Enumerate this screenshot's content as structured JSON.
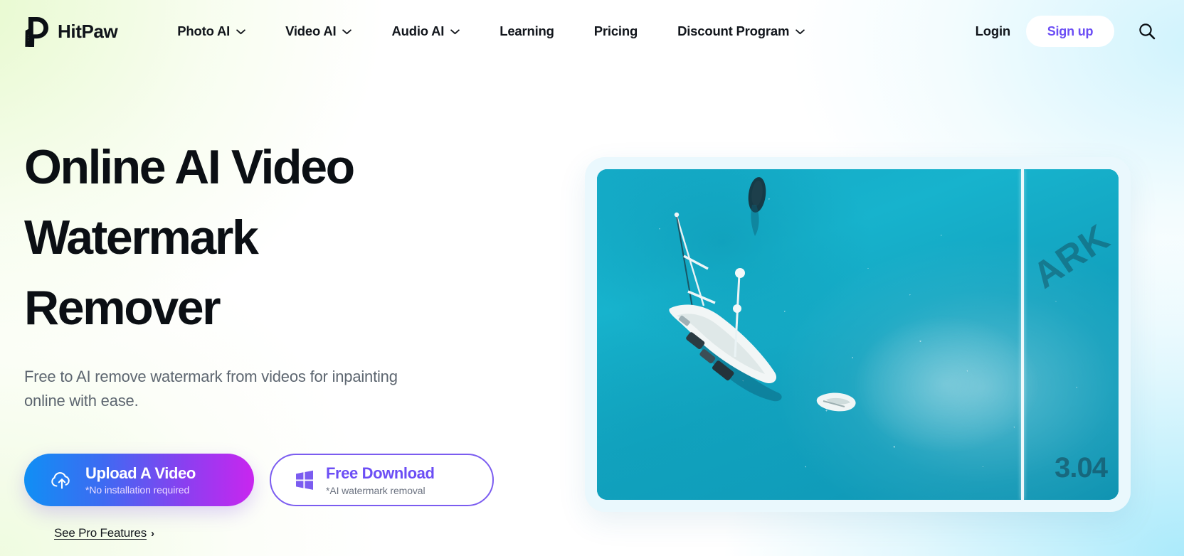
{
  "brand": {
    "name": "HitPaw",
    "logo_icon": "hitpaw-paw-logo-icon"
  },
  "nav": {
    "items": [
      {
        "label": "Photo AI",
        "has_caret": true,
        "caret_icon": "chevron-down-icon"
      },
      {
        "label": "Video AI",
        "has_caret": true,
        "caret_icon": "chevron-down-icon"
      },
      {
        "label": "Audio AI",
        "has_caret": true,
        "caret_icon": "chevron-down-icon"
      },
      {
        "label": "Learning",
        "has_caret": false
      },
      {
        "label": "Pricing",
        "has_caret": false
      },
      {
        "label": "Discount Program",
        "has_caret": true,
        "caret_icon": "chevron-down-icon"
      }
    ],
    "login_label": "Login",
    "signup_label": "Sign up",
    "search_icon": "search-icon"
  },
  "hero": {
    "title_lines": [
      "Online AI Video",
      "Watermark",
      "Remover"
    ],
    "title_full": "Online AI Video Watermark Remover",
    "subtitle": "Free to AI remove watermark from videos for inpainting online with ease.",
    "upload_button": {
      "label": "Upload A Video",
      "note": "*No installation required",
      "icon": "cloud-upload-icon"
    },
    "download_button": {
      "label": "Free Download",
      "note": "*AI watermark removal",
      "icon": "windows-logo-icon"
    },
    "pro_link": {
      "label": "See Pro Features",
      "arrow": "›",
      "arrow_icon": "chevron-right-icon"
    }
  },
  "preview": {
    "description": "Aerial view of a white sailboat anchored on turquoise water with a small dinghy and a motorboat",
    "watermark_text": "ARK",
    "timecode_text": "3.04",
    "divider_icon": "before-after-divider"
  },
  "colors": {
    "accent_purple": "#6c4ef5",
    "accent_purple_border": "#7b5cf0",
    "gradient_start": "#108ff4",
    "gradient_end": "#c926ef",
    "text_dark": "#0b0f14",
    "text_muted": "#5d6670",
    "frame_light": "#eaf8fd",
    "bg_green": "#e2f8c4",
    "bg_cyan": "#96e5fa"
  }
}
